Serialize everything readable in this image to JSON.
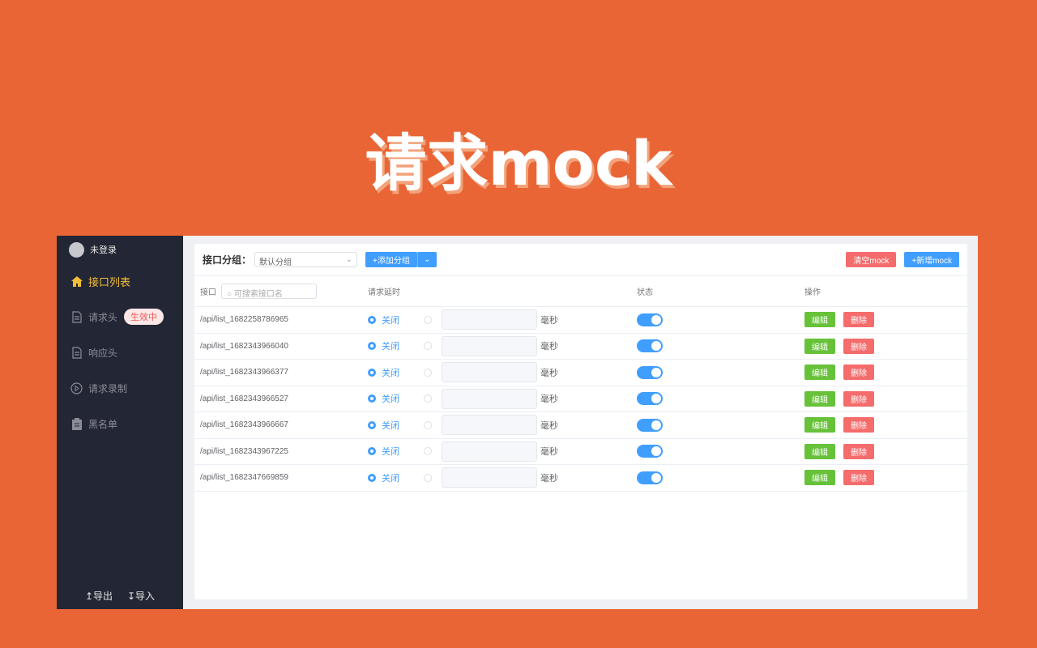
{
  "hero_title": "请求mock",
  "sidebar": {
    "user": "未登录",
    "items": [
      {
        "label": "接口列表",
        "icon": "home-icon"
      },
      {
        "label": "请求头",
        "icon": "document-icon",
        "badge": "生效中"
      },
      {
        "label": "响应头",
        "icon": "document-icon"
      },
      {
        "label": "请求录制",
        "icon": "play-circle-icon"
      },
      {
        "label": "黑名单",
        "icon": "clipboard-icon"
      }
    ],
    "export": "↥导出",
    "import": "↧导入"
  },
  "toolbar": {
    "group_label": "接口分组：",
    "group_value": "默认分组",
    "add_group": "+添加分组",
    "clear": "清空mock",
    "add_mock": "+新增mock"
  },
  "table": {
    "headers": {
      "api": "接口",
      "delay": "请求延时",
      "status": "状态",
      "actions": "操作"
    },
    "search_placeholder": "可搜索接口名",
    "off_label": "关闭",
    "unit": "毫秒",
    "edit": "编辑",
    "delete": "删除",
    "rows": [
      {
        "api": "/api/list_1682258786965",
        "enabled": true
      },
      {
        "api": "/api/list_1682343966040",
        "enabled": true
      },
      {
        "api": "/api/list_1682343966377",
        "enabled": true
      },
      {
        "api": "/api/list_1682343966527",
        "enabled": true
      },
      {
        "api": "/api/list_1682343966667",
        "enabled": true
      },
      {
        "api": "/api/list_1682343967225",
        "enabled": true
      },
      {
        "api": "/api/list_1682347669859",
        "enabled": true
      }
    ]
  },
  "colors": {
    "background": "#E96535",
    "sidebar": "#232634",
    "primary": "#409eff",
    "danger": "#f56c6c",
    "success": "#67c23a",
    "active_nav": "#f2be3a"
  }
}
